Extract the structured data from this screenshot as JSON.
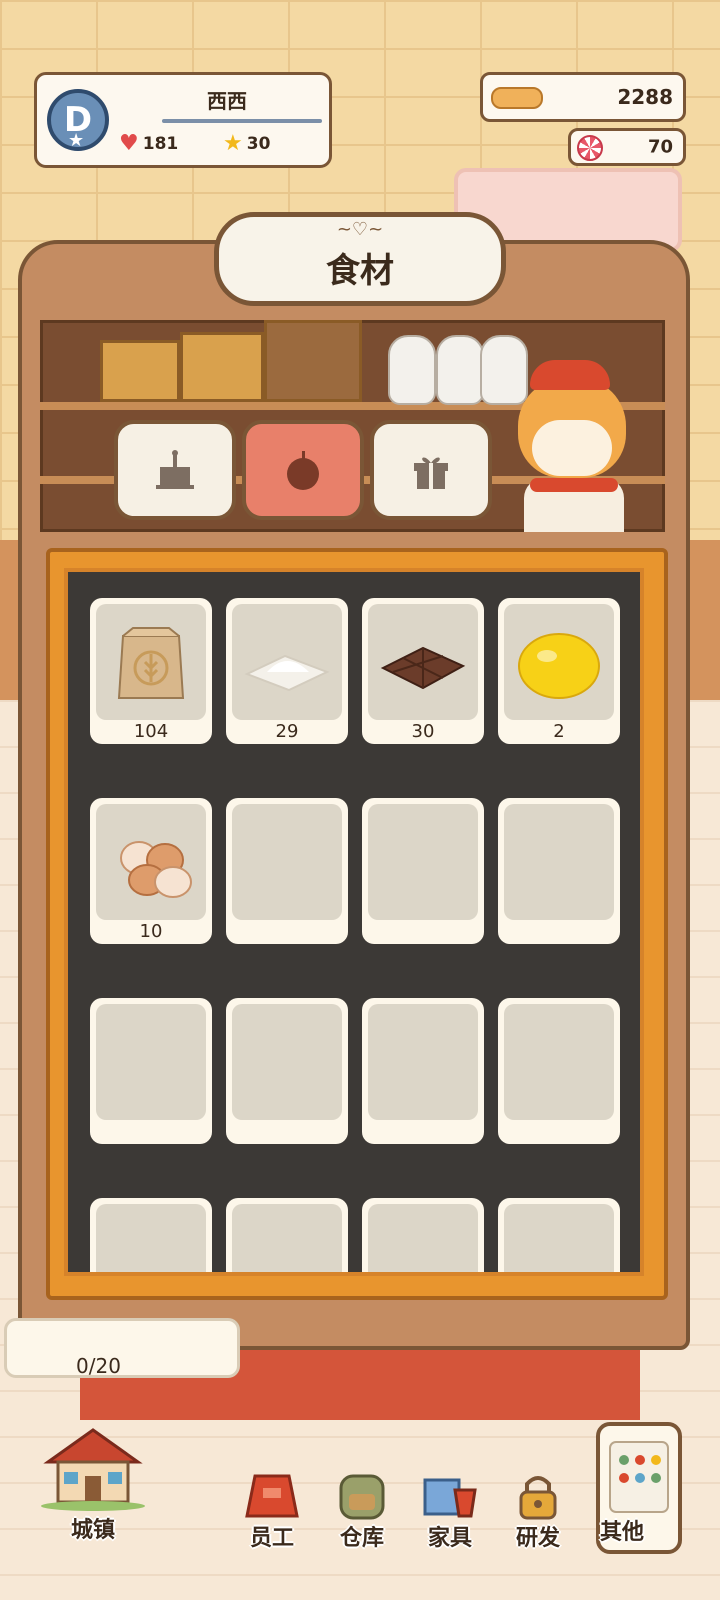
{
  "player": {
    "name": "西西",
    "level_badge": "D",
    "hearts": "181",
    "stars": "30"
  },
  "currency": {
    "bones": "2288",
    "candy": "70"
  },
  "title": "食材",
  "tabs": [
    {
      "name": "desserts",
      "icon": "cake-icon",
      "active": false
    },
    {
      "name": "ingredients",
      "icon": "apple-icon",
      "active": true
    },
    {
      "name": "gifts",
      "icon": "gift-icon",
      "active": false
    }
  ],
  "items": [
    {
      "icon": "flour-bag-icon",
      "count": "104"
    },
    {
      "icon": "sugar-icon",
      "count": "29"
    },
    {
      "icon": "chocolate-icon",
      "count": "30"
    },
    {
      "icon": "lemon-icon",
      "count": "2"
    },
    {
      "icon": "eggs-icon",
      "count": "10"
    }
  ],
  "capacity": "0/20",
  "nav": {
    "town": "城镇",
    "staff": "员工",
    "warehouse": "仓库",
    "furniture": "家具",
    "research": "研发",
    "other": "其他"
  },
  "colors": {
    "active_tab": "#e8806a",
    "board": "#3c3936",
    "frame": "#e8952e",
    "text": "#3b2a1c"
  }
}
